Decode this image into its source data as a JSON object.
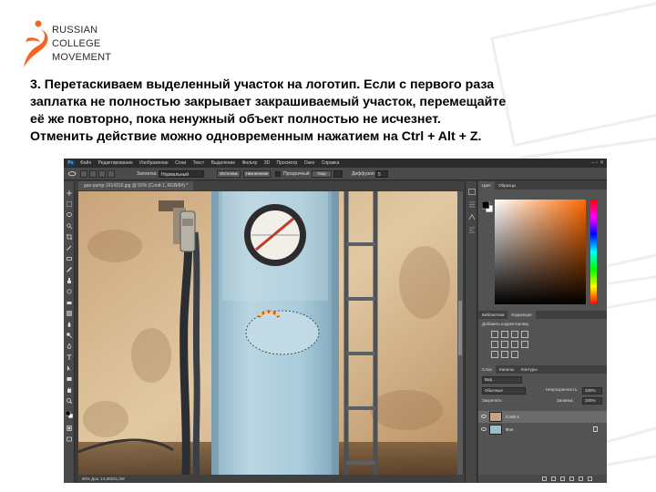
{
  "logo": {
    "line1": "RUSSIAN",
    "line2": "COLLEGE",
    "line3": "MOVEMENT",
    "accent_color": "#f26522"
  },
  "instruction": {
    "line1": "3. Перетаскиваем выделенный участок на логотип. Если с первого раза",
    "line2": "заплатка не полностью закрывает закрашиваемый участок, перемещайте",
    "line3": "её же повторно, пока ненужный объект полностью не исчезнет.",
    "line4": "Отменить действие можно одновременным нажатием на Ctrl + Alt + Z."
  },
  "photoshop": {
    "app_icon": "Ps",
    "menu": [
      "Файл",
      "Редактирование",
      "Изображение",
      "Слои",
      "Текст",
      "Выделение",
      "Фильтр",
      "3D",
      "Просмотр",
      "Окно",
      "Справка"
    ],
    "options": {
      "mode_label": "Заплатка:",
      "mode_value": "Нормальный",
      "source_button": "Источник",
      "target_button": "Назначение",
      "transparent_label": "Прозрачный",
      "use_pattern_label": "Узор",
      "diffusion_label": "Диффузия:",
      "diffusion_value": "5"
    },
    "document_tab": "gas-pump-1914316.jpg @ 50% (Слой 1, RGB/8#) *",
    "status_bar": "50%        Док: 14,6M/31,2M",
    "panels": {
      "color_tabs": [
        "Цвет",
        "Образцы"
      ],
      "adjust_tabs": [
        "Библиотеки",
        "Коррекция"
      ],
      "adjust_label": "Добавить корректировку",
      "layers_tabs": [
        "Слои",
        "Каналы",
        "Контуры"
      ],
      "filter_label": "Вид",
      "blend_mode": "Обычные",
      "opacity_label": "Непрозрачность:",
      "opacity_value": "100%",
      "lock_label": "Закрепить:",
      "fill_label": "Заливка:",
      "fill_value": "100%",
      "layers": [
        {
          "name": "Слой 1",
          "selected": true
        },
        {
          "name": "Фон",
          "selected": false
        }
      ]
    },
    "icons": {
      "move": "move-icon",
      "marquee": "marquee-icon",
      "lasso": "lasso-icon",
      "patch": "patch-icon",
      "brush": "brush-icon",
      "eye": "eye-icon",
      "lock": "lock-icon"
    }
  }
}
